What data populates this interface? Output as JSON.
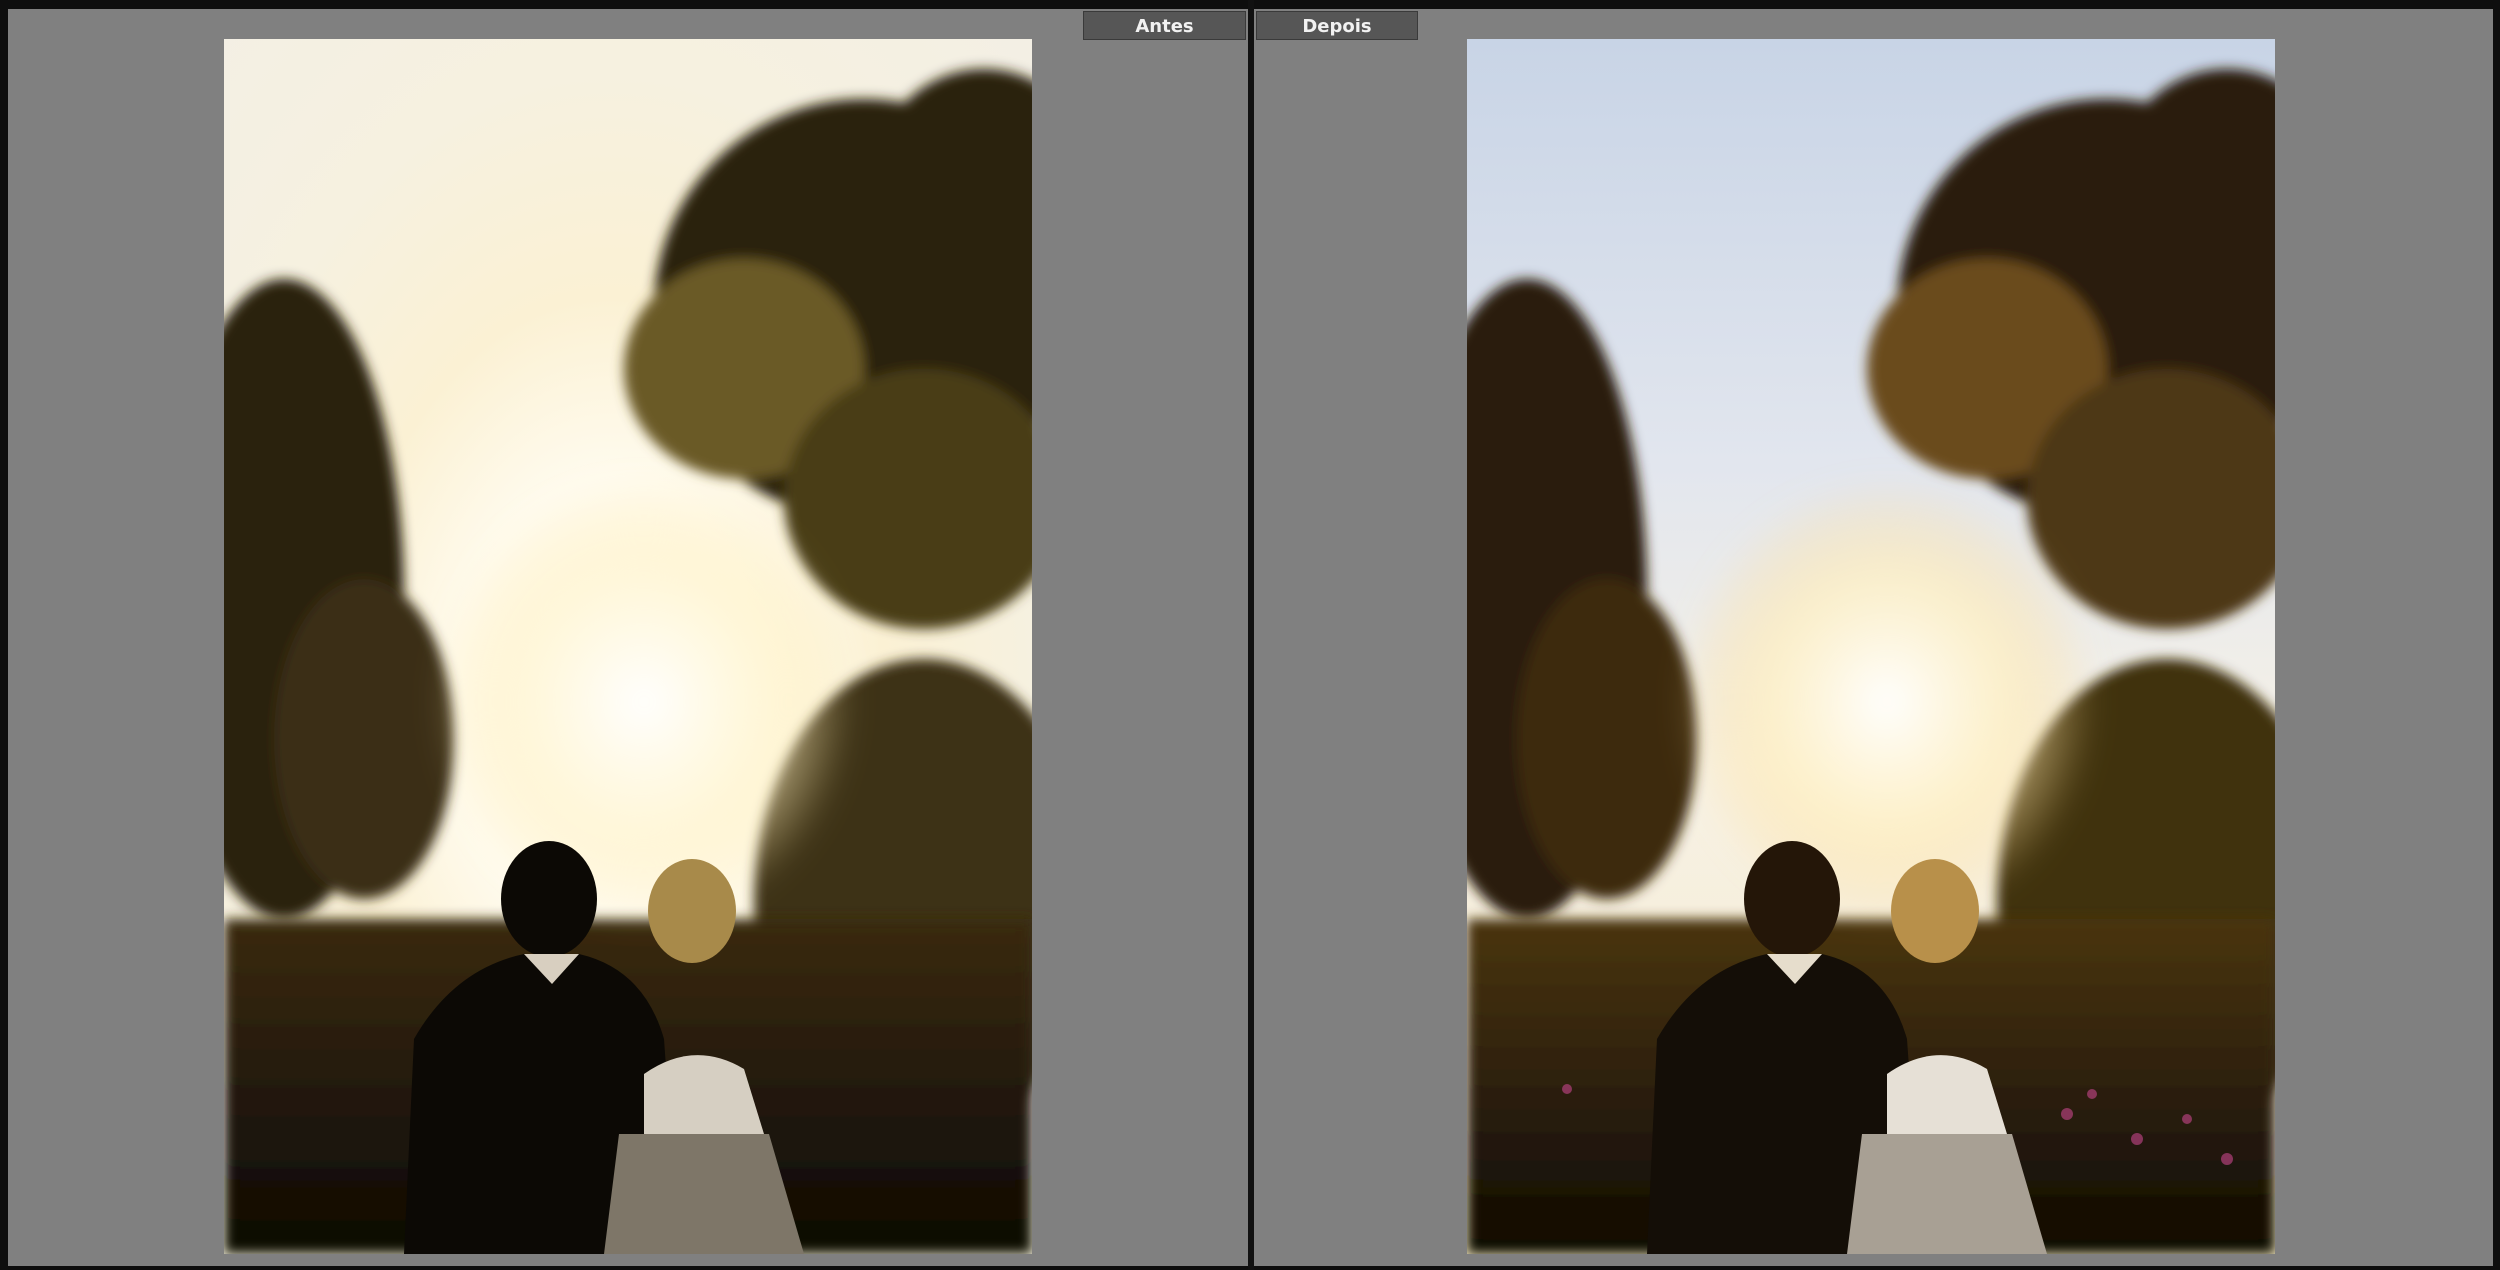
{
  "comparison": {
    "before_label": "Antes",
    "after_label": "Depois"
  },
  "colors": {
    "workspace_gray": "#808080",
    "frame_dark": "#0e0e0e",
    "tab_bg": "#565656",
    "tab_text": "#f2f2f2"
  },
  "photos": {
    "before": {
      "icon": "photo-wedding-couple-sunset-before"
    },
    "after": {
      "icon": "photo-wedding-couple-sunset-after"
    }
  }
}
